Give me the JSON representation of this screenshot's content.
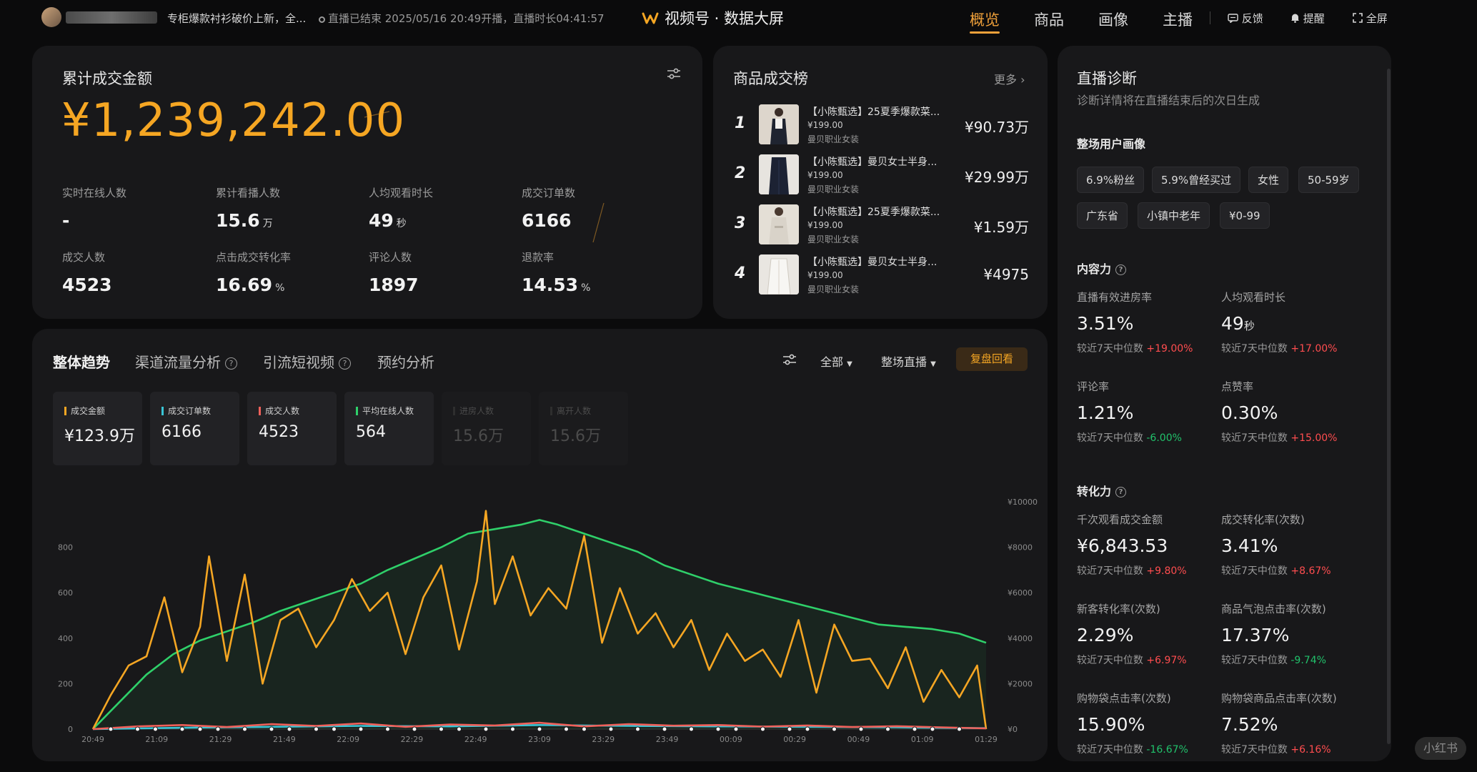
{
  "topbar": {
    "live_title": "专柜爆款衬衫破价上新，全...",
    "live_status": "直播已结束 2025/05/16 20:49开播，直播时长04:41:57",
    "brand": "视频号 · 数据大屏",
    "nav": [
      "概览",
      "商品",
      "画像",
      "主播"
    ],
    "active_nav": "概览",
    "tools": {
      "feedback": "反馈",
      "remind": "提醒",
      "fullscreen": "全屏"
    }
  },
  "summary": {
    "title": "累计成交金额",
    "amount": "¥1,239,242.00",
    "metrics": [
      {
        "label": "实时在线人数",
        "value": "-",
        "unit": ""
      },
      {
        "label": "累计看播人数",
        "value": "15.6",
        "unit": "万"
      },
      {
        "label": "人均观看时长",
        "value": "49",
        "unit": "秒"
      },
      {
        "label": "成交订单数",
        "value": "6166",
        "unit": ""
      },
      {
        "label": "成交人数",
        "value": "4523",
        "unit": ""
      },
      {
        "label": "点击成交转化率",
        "value": "16.69",
        "unit": "%"
      },
      {
        "label": "评论人数",
        "value": "1897",
        "unit": ""
      },
      {
        "label": "退款率",
        "value": "14.53",
        "unit": "%"
      }
    ]
  },
  "ranking": {
    "title": "商品成交榜",
    "more": "更多",
    "items": [
      {
        "rank": "1",
        "name": "【小陈甄选】25夏季爆款菜...",
        "price": "¥199.00",
        "shop": "曼贝职业女装",
        "sales": "¥90.73万"
      },
      {
        "rank": "2",
        "name": "【小陈甄选】曼贝女士半身...",
        "price": "¥199.00",
        "shop": "曼贝职业女装",
        "sales": "¥29.99万"
      },
      {
        "rank": "3",
        "name": "【小陈甄选】25夏季爆款菜...",
        "price": "¥199.00",
        "shop": "曼贝职业女装",
        "sales": "¥1.59万"
      },
      {
        "rank": "4",
        "name": "【小陈甄选】曼贝女士半身...",
        "price": "¥199.00",
        "shop": "曼贝职业女装",
        "sales": "¥4975"
      }
    ]
  },
  "trend": {
    "tabs": [
      "整体趋势",
      "渠道流量分析",
      "引流短视频",
      "预约分析"
    ],
    "filter_all": "全部",
    "filter_scope": "整场直播",
    "replay": "复盘回看",
    "stats": [
      {
        "label": "成交金额",
        "value": "¥123.9万",
        "color": "#f5a623",
        "active": true
      },
      {
        "label": "成交订单数",
        "value": "6166",
        "color": "#39c5d6",
        "active": true
      },
      {
        "label": "成交人数",
        "value": "4523",
        "color": "#f0605a",
        "active": true
      },
      {
        "label": "平均在线人数",
        "value": "564",
        "color": "#2fd06a",
        "active": true
      },
      {
        "label": "进房人数",
        "value": "15.6万",
        "color": "#3a3a3a",
        "active": false
      },
      {
        "label": "离开人数",
        "value": "15.6万",
        "color": "#3a3a3a",
        "active": false
      }
    ]
  },
  "chart_data": {
    "type": "line",
    "x_ticks": [
      "20:49",
      "21:09",
      "21:29",
      "21:49",
      "22:09",
      "22:29",
      "22:49",
      "23:09",
      "23:29",
      "23:49",
      "00:09",
      "00:29",
      "00:49",
      "01:09",
      "01:29"
    ],
    "y_left_ticks": [
      "0",
      "200",
      "400",
      "600",
      "800"
    ],
    "y_right_ticks": [
      "¥0",
      "¥2000",
      "¥4000",
      "¥6000",
      "¥8000",
      "¥10000"
    ],
    "ylim_left": [
      0,
      1000
    ],
    "ylim_right": [
      0,
      10000
    ],
    "series": [
      {
        "name": "平均在线人数",
        "axis": "left",
        "color": "#2fd06a",
        "x": [
          0,
          0.03,
          0.06,
          0.09,
          0.12,
          0.15,
          0.18,
          0.21,
          0.24,
          0.27,
          0.3,
          0.33,
          0.36,
          0.39,
          0.42,
          0.45,
          0.48,
          0.5,
          0.52,
          0.55,
          0.58,
          0.61,
          0.64,
          0.67,
          0.7,
          0.73,
          0.76,
          0.79,
          0.82,
          0.85,
          0.88,
          0.91,
          0.94,
          0.97,
          1.0
        ],
        "values": [
          0,
          120,
          240,
          330,
          390,
          430,
          470,
          520,
          560,
          600,
          640,
          700,
          750,
          800,
          860,
          880,
          900,
          920,
          900,
          860,
          820,
          780,
          720,
          680,
          640,
          610,
          580,
          550,
          520,
          490,
          460,
          450,
          440,
          420,
          380
        ]
      },
      {
        "name": "成交金额",
        "axis": "right",
        "color": "#f5a623",
        "x": [
          0,
          0.02,
          0.04,
          0.06,
          0.08,
          0.1,
          0.12,
          0.13,
          0.15,
          0.17,
          0.19,
          0.21,
          0.23,
          0.25,
          0.27,
          0.29,
          0.31,
          0.33,
          0.35,
          0.37,
          0.39,
          0.41,
          0.43,
          0.44,
          0.45,
          0.47,
          0.49,
          0.51,
          0.53,
          0.55,
          0.57,
          0.59,
          0.61,
          0.63,
          0.65,
          0.67,
          0.69,
          0.71,
          0.73,
          0.75,
          0.77,
          0.79,
          0.81,
          0.83,
          0.85,
          0.87,
          0.89,
          0.91,
          0.93,
          0.95,
          0.97,
          0.99,
          1.0
        ],
        "values": [
          0,
          1500,
          2800,
          3200,
          5800,
          2500,
          4500,
          7600,
          3000,
          6800,
          2000,
          4800,
          5300,
          3600,
          4800,
          6600,
          5200,
          6000,
          3300,
          5800,
          7200,
          3500,
          6500,
          9600,
          5500,
          7600,
          5000,
          6200,
          5300,
          8500,
          3800,
          6200,
          4200,
          5100,
          3600,
          4800,
          2600,
          4200,
          3000,
          3500,
          2300,
          4800,
          1600,
          4600,
          3000,
          3100,
          1800,
          3600,
          1200,
          2600,
          1400,
          2800,
          0
        ]
      },
      {
        "name": "成交订单数",
        "axis": "left",
        "color": "#39c5d6",
        "x": [
          0,
          0.1,
          0.2,
          0.3,
          0.4,
          0.5,
          0.6,
          0.7,
          0.8,
          0.9,
          1.0
        ],
        "values": [
          0,
          6,
          10,
          14,
          12,
          18,
          14,
          12,
          10,
          8,
          4
        ]
      },
      {
        "name": "成交人数",
        "axis": "left",
        "color": "#f0605a",
        "x": [
          0,
          0.05,
          0.1,
          0.15,
          0.2,
          0.25,
          0.3,
          0.35,
          0.4,
          0.45,
          0.5,
          0.55,
          0.6,
          0.65,
          0.7,
          0.75,
          0.8,
          0.85,
          0.9,
          0.95,
          1.0
        ],
        "values": [
          0,
          12,
          18,
          9,
          22,
          14,
          25,
          10,
          20,
          16,
          28,
          12,
          22,
          15,
          18,
          11,
          16,
          9,
          13,
          8,
          3
        ]
      }
    ]
  },
  "diagnosis": {
    "title": "直播诊断",
    "subtitle": "诊断详情将在直播结束后的次日生成",
    "portrait_title": "整场用户画像",
    "tags_row1": [
      "6.9%粉丝",
      "5.9%曾经买过",
      "女性",
      "50-59岁"
    ],
    "tags_row2": [
      "广东省",
      "小镇中老年",
      "¥0-99"
    ],
    "content_title": "内容力",
    "content_metrics": [
      {
        "label": "直播有效进房率",
        "value": "3.51%",
        "unit": "",
        "cmp": "较近7天中位数",
        "delta": "+19.00%",
        "dir": "up"
      },
      {
        "label": "人均观看时长",
        "value": "49",
        "unit": "秒",
        "cmp": "较近7天中位数",
        "delta": "+17.00%",
        "dir": "up"
      },
      {
        "label": "评论率",
        "value": "1.21%",
        "unit": "",
        "cmp": "较近7天中位数",
        "delta": "-6.00%",
        "dir": "down"
      },
      {
        "label": "点赞率",
        "value": "0.30%",
        "unit": "",
        "cmp": "较近7天中位数",
        "delta": "+15.00%",
        "dir": "up"
      }
    ],
    "conversion_title": "转化力",
    "conversion_metrics": [
      {
        "label": "千次观看成交金额",
        "value": "¥6,843.53",
        "unit": "",
        "cmp": "较近7天中位数",
        "delta": "+9.80%",
        "dir": "up"
      },
      {
        "label": "成交转化率(次数)",
        "value": "3.41%",
        "unit": "",
        "cmp": "较近7天中位数",
        "delta": "+8.67%",
        "dir": "up"
      },
      {
        "label": "新客转化率(次数)",
        "value": "2.29%",
        "unit": "",
        "cmp": "较近7天中位数",
        "delta": "+6.97%",
        "dir": "up"
      },
      {
        "label": "商品气泡点击率(次数)",
        "value": "17.37%",
        "unit": "",
        "cmp": "较近7天中位数",
        "delta": "-9.74%",
        "dir": "down"
      },
      {
        "label": "购物袋点击率(次数)",
        "value": "15.90%",
        "unit": "",
        "cmp": "较近7天中位数",
        "delta": "-16.67%",
        "dir": "down"
      },
      {
        "label": "购物袋商品点击率(次数)",
        "value": "7.52%",
        "unit": "",
        "cmp": "较近7天中位数",
        "delta": "+6.16%",
        "dir": "up"
      }
    ]
  },
  "watermark": "小红书"
}
